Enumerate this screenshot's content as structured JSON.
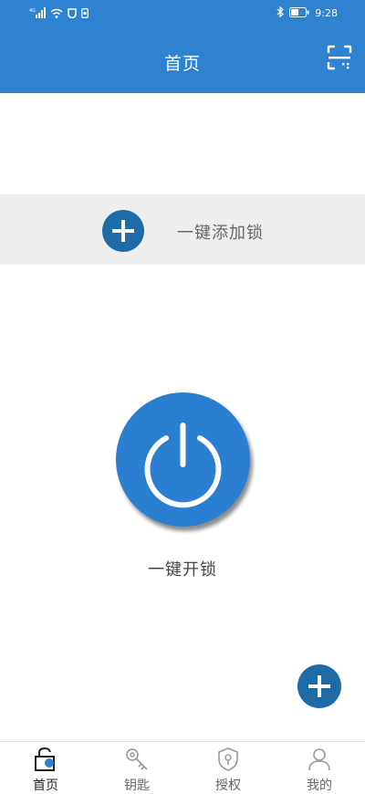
{
  "status_bar": {
    "network_text": "4G",
    "time": "9:28",
    "icons": [
      "signal-icon",
      "wifi-icon",
      "shield-app-icon",
      "sim-icon",
      "bluetooth-icon",
      "battery-icon"
    ]
  },
  "header": {
    "title": "首页",
    "scan_icon": "scan-icon",
    "color": "#2f82cf"
  },
  "add_lock": {
    "label": "一键添加锁",
    "icon": "plus-icon"
  },
  "unlock": {
    "label": "一键开锁",
    "icon": "power-icon",
    "color": "#2a7fd0"
  },
  "fab": {
    "icon": "plus-icon",
    "color": "#1f6ba6"
  },
  "tabbar": {
    "active": "首页",
    "tabs": [
      {
        "label": "首页",
        "icon": "home-lock-icon"
      },
      {
        "label": "钥匙",
        "icon": "key-icon"
      },
      {
        "label": "授权",
        "icon": "authorize-shield-icon"
      },
      {
        "label": "我的",
        "icon": "profile-icon"
      }
    ]
  }
}
